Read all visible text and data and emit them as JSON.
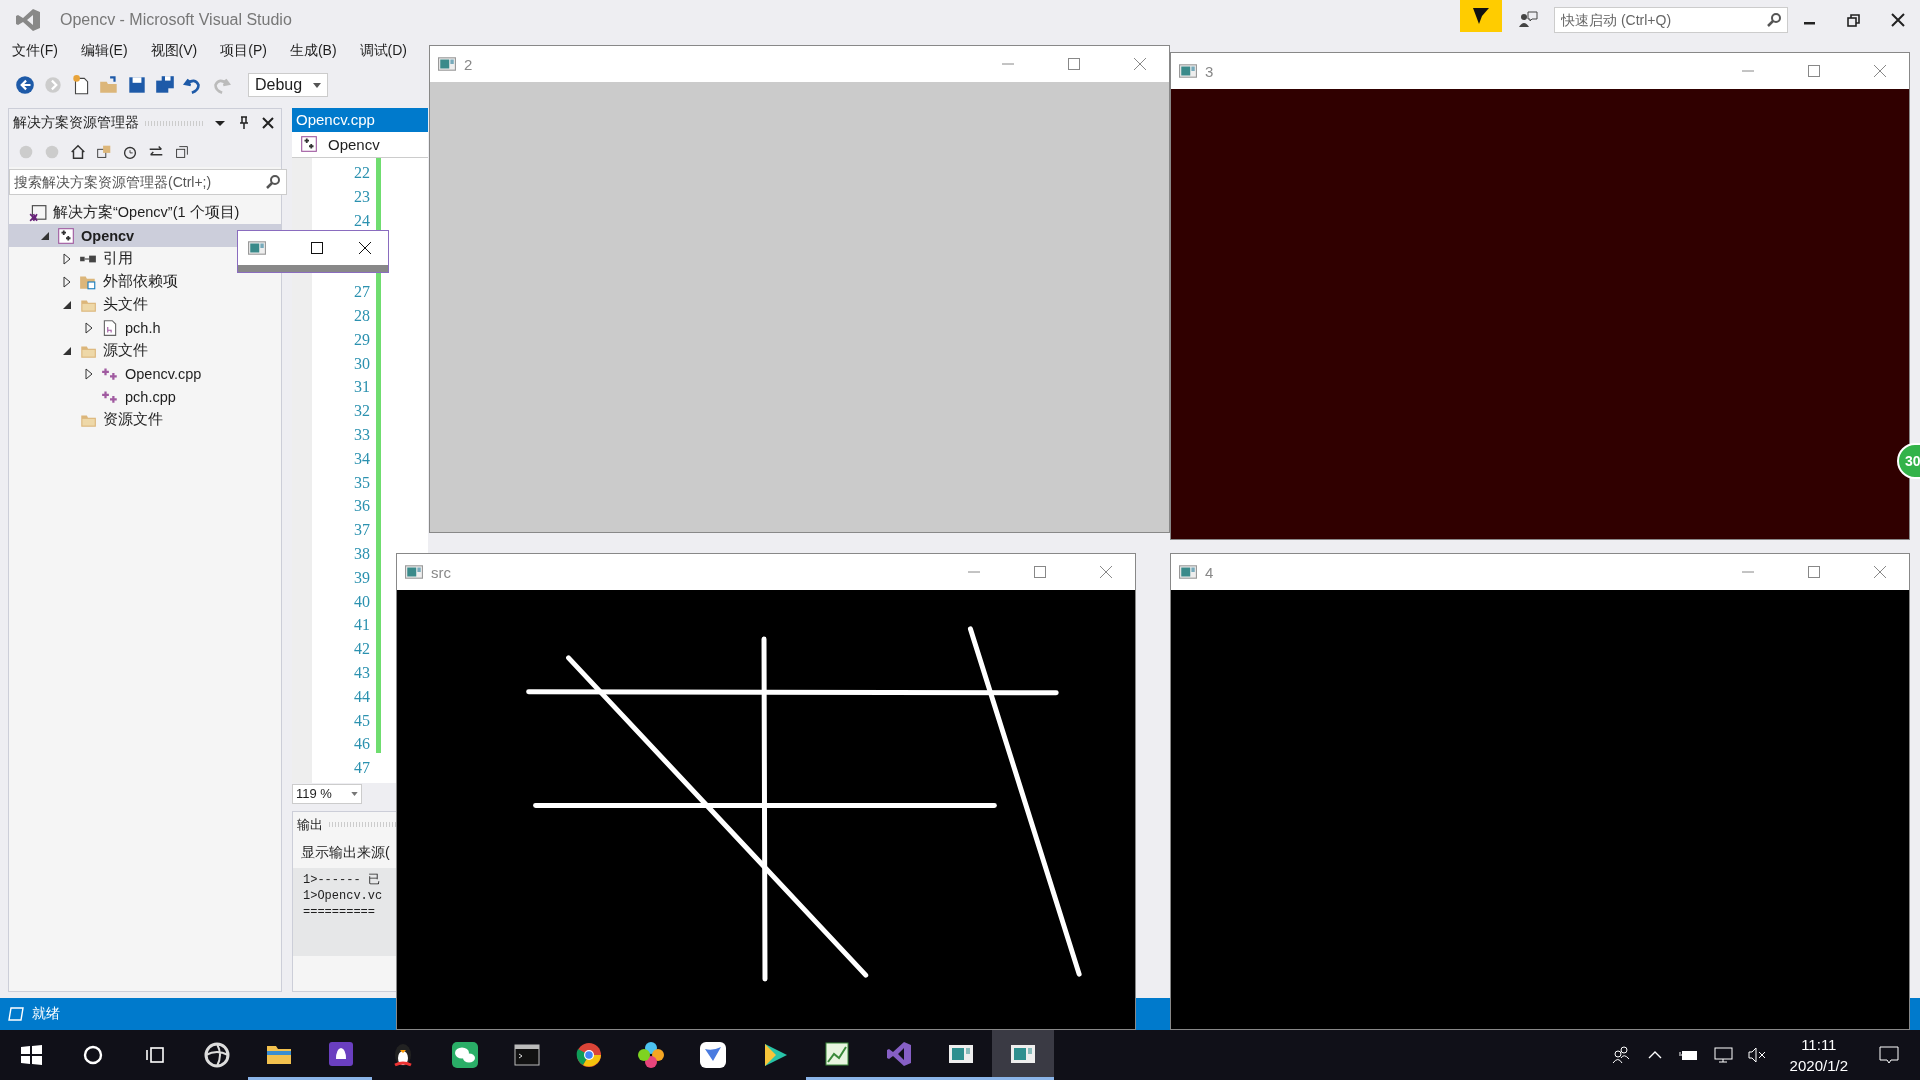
{
  "window": {
    "title": "Opencv - Microsoft Visual Studio"
  },
  "quick_launch": {
    "placeholder": "快速启动 (Ctrl+Q)"
  },
  "menu": [
    "文件(F)",
    "编辑(E)",
    "视图(V)",
    "项目(P)",
    "生成(B)",
    "调试(D)"
  ],
  "toolbar": {
    "configuration": "Debug"
  },
  "solution_explorer": {
    "title": "解决方案资源管理器",
    "search": {
      "placeholder": "搜索解决方案资源管理器(Ctrl+;)"
    },
    "tree": [
      {
        "label": "解决方案“Opencv”(1 个项目)",
        "kind": "solution",
        "selected": false,
        "children": [
          {
            "label": "Opencv",
            "kind": "project",
            "expanded": true,
            "selected": true,
            "children": [
              {
                "label": "引用",
                "kind": "references",
                "expanded": false,
                "selected": false
              },
              {
                "label": "外部依赖项",
                "kind": "external",
                "expanded": false,
                "selected": false
              },
              {
                "label": "头文件",
                "kind": "folder",
                "expanded": true,
                "selected": false,
                "children": [
                  {
                    "label": "pch.h",
                    "kind": "header",
                    "expanded": false,
                    "selected": false
                  }
                ]
              },
              {
                "label": "源文件",
                "kind": "folder",
                "expanded": true,
                "selected": false,
                "children": [
                  {
                    "label": "Opencv.cpp",
                    "kind": "cpp",
                    "expanded": false,
                    "selected": false
                  },
                  {
                    "label": "pch.cpp",
                    "kind": "cpp",
                    "selected": false
                  }
                ]
              },
              {
                "label": "资源文件",
                "kind": "folder",
                "selected": false
              }
            ]
          }
        ]
      }
    ]
  },
  "editor": {
    "tab": {
      "label": "Opencv.cpp",
      "selected": true
    },
    "scope": "Opencv",
    "line_number_blocks": [
      [
        "22",
        "23",
        "24"
      ],
      [
        "27",
        "28",
        "29",
        "30",
        "31",
        "32",
        "33",
        "34",
        "35",
        "36",
        "37",
        "38",
        "39",
        "40",
        "41",
        "42",
        "43",
        "44",
        "45",
        "46",
        "47"
      ]
    ],
    "zoom": "119 %"
  },
  "output": {
    "title": "输出",
    "source_label": "显示输出来源(",
    "lines": [
      "1>------ 已",
      "1>Opencv.vc",
      "=========="
    ]
  },
  "status_bar": {
    "text": "就绪"
  },
  "image_windows": [
    {
      "title": "2",
      "kind": "fill",
      "color": "#cbcbcb"
    },
    {
      "title": "3",
      "kind": "fill",
      "color": "#300000"
    },
    {
      "title": "src",
      "kind": "lines"
    },
    {
      "title": "4",
      "kind": "fill",
      "color": "#000000"
    }
  ],
  "side_badge": "30",
  "taskbar": {
    "apps": [
      {
        "kind": "pinwheel",
        "running": false,
        "selected": false
      },
      {
        "kind": "folder",
        "running": true,
        "selected": false
      },
      {
        "kind": "bell",
        "running": true,
        "selected": false
      },
      {
        "kind": "penguin",
        "running": false,
        "selected": false
      },
      {
        "kind": "chat",
        "running": false,
        "selected": false
      },
      {
        "kind": "terminal",
        "running": false,
        "selected": false
      },
      {
        "kind": "browser",
        "running": false,
        "selected": false
      },
      {
        "kind": "petals",
        "running": false,
        "selected": false
      },
      {
        "kind": "feather",
        "running": false,
        "selected": false
      },
      {
        "kind": "play",
        "running": false,
        "selected": false
      },
      {
        "kind": "chart",
        "running": true,
        "selected": false
      },
      {
        "kind": "studio",
        "running": true,
        "selected": false
      },
      {
        "kind": "window",
        "running": true,
        "selected": false
      },
      {
        "kind": "window",
        "running": true,
        "selected": true
      }
    ],
    "time": "11:11",
    "date": "2020/1/2"
  }
}
